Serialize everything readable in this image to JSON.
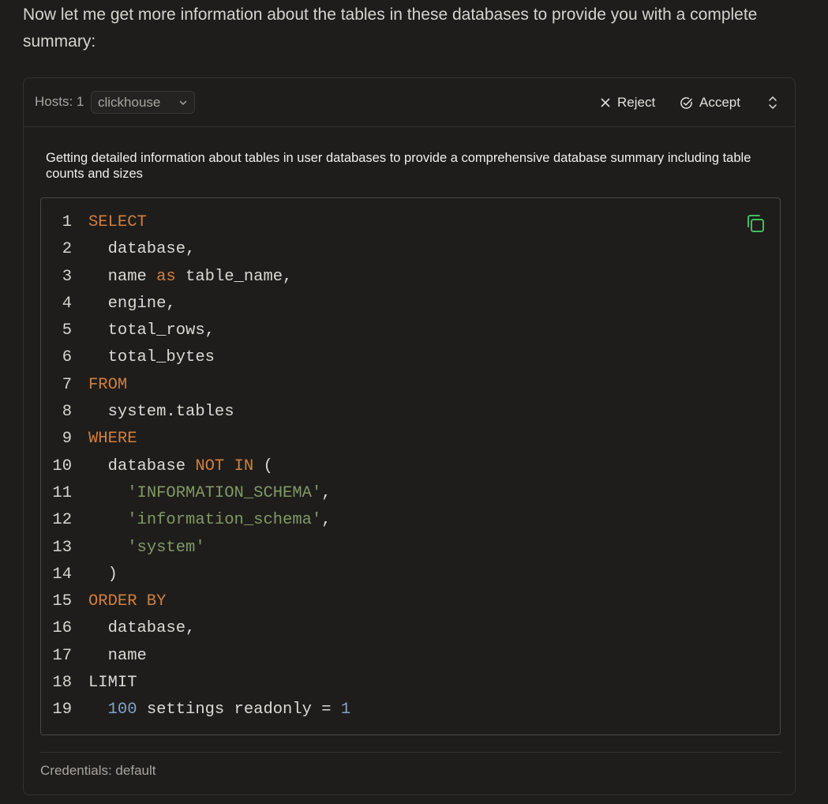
{
  "intro_text": "Now let me get more information about the tables in these databases to provide you with a complete summary:",
  "header": {
    "hosts_label": "Hosts: 1",
    "host_selected": "clickhouse",
    "reject_label": "Reject",
    "accept_label": "Accept"
  },
  "description": "Getting detailed information about tables in user databases to provide a comprehensive database summary including table counts and sizes",
  "code": {
    "language": "sql",
    "lines": [
      [
        {
          "t": "kw",
          "v": "SELECT"
        }
      ],
      [
        {
          "t": "txt",
          "v": "  database,"
        }
      ],
      [
        {
          "t": "txt",
          "v": "  name "
        },
        {
          "t": "kw",
          "v": "as"
        },
        {
          "t": "txt",
          "v": " table_name,"
        }
      ],
      [
        {
          "t": "txt",
          "v": "  engine,"
        }
      ],
      [
        {
          "t": "txt",
          "v": "  total_rows,"
        }
      ],
      [
        {
          "t": "txt",
          "v": "  total_bytes"
        }
      ],
      [
        {
          "t": "kw",
          "v": "FROM"
        }
      ],
      [
        {
          "t": "txt",
          "v": "  system.tables"
        }
      ],
      [
        {
          "t": "kw",
          "v": "WHERE"
        }
      ],
      [
        {
          "t": "txt",
          "v": "  database "
        },
        {
          "t": "kw",
          "v": "NOT IN"
        },
        {
          "t": "txt",
          "v": " ("
        }
      ],
      [
        {
          "t": "txt",
          "v": "    "
        },
        {
          "t": "str",
          "v": "'INFORMATION_SCHEMA'"
        },
        {
          "t": "txt",
          "v": ","
        }
      ],
      [
        {
          "t": "txt",
          "v": "    "
        },
        {
          "t": "str",
          "v": "'information_schema'"
        },
        {
          "t": "txt",
          "v": ","
        }
      ],
      [
        {
          "t": "txt",
          "v": "    "
        },
        {
          "t": "str",
          "v": "'system'"
        }
      ],
      [
        {
          "t": "txt",
          "v": "  )"
        }
      ],
      [
        {
          "t": "kw",
          "v": "ORDER BY"
        }
      ],
      [
        {
          "t": "txt",
          "v": "  database,"
        }
      ],
      [
        {
          "t": "txt",
          "v": "  name"
        }
      ],
      [
        {
          "t": "txt",
          "v": "LIMIT"
        }
      ],
      [
        {
          "t": "txt",
          "v": "  "
        },
        {
          "t": "num",
          "v": "100"
        },
        {
          "t": "txt",
          "v": " settings readonly = "
        },
        {
          "t": "num",
          "v": "1"
        }
      ]
    ]
  },
  "footer": {
    "credentials_text": "Credentials: default"
  },
  "colors": {
    "background": "#1f1d1b",
    "keyword": "#d27f3f",
    "string": "#7f9a66",
    "number": "#7fa3c9",
    "copy_icon": "#3fbf5f"
  },
  "icons": {
    "reject": "close-icon",
    "accept": "check-circle-icon",
    "expand": "chevron-up-down-icon",
    "copy": "copy-icon",
    "select": "chevron-down-icon"
  }
}
